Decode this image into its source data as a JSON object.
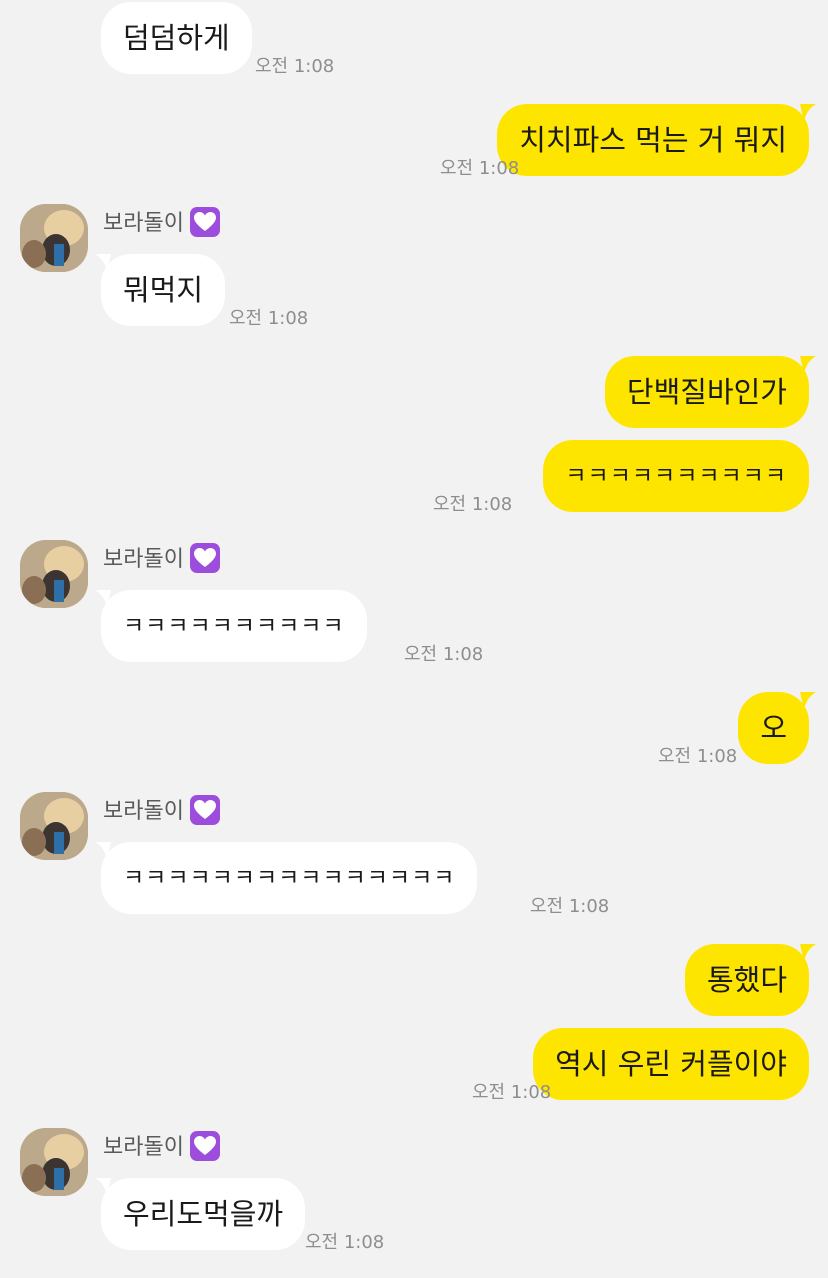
{
  "sender_name": "보라돌이",
  "colors": {
    "incoming_bubble": "#ffffff",
    "outgoing_bubble": "#fee500",
    "background": "#f2f2f2",
    "heart_badge": "#9d4ddb"
  },
  "messages": [
    {
      "dir": "in",
      "text": "덤덤하게",
      "time": "오전 1:08"
    },
    {
      "dir": "out",
      "text": "치치파스 먹는 거 뭐지",
      "time": "오전 1:08"
    },
    {
      "dir": "in",
      "text": "뭐먹지",
      "time": "오전 1:08"
    },
    {
      "dir": "out",
      "text": "단백질바인가",
      "time": ""
    },
    {
      "dir": "out",
      "text": "ㅋㅋㅋㅋㅋㅋㅋㅋㅋㅋ",
      "time": "오전 1:08"
    },
    {
      "dir": "in",
      "text": "ㅋㅋㅋㅋㅋㅋㅋㅋㅋㅋ",
      "time": "오전 1:08"
    },
    {
      "dir": "out",
      "text": "오",
      "time": "오전 1:08"
    },
    {
      "dir": "in",
      "text": "ㅋㅋㅋㅋㅋㅋㅋㅋㅋㅋㅋㅋㅋㅋㅋ",
      "time": "오전 1:08"
    },
    {
      "dir": "out",
      "text": "통했다",
      "time": ""
    },
    {
      "dir": "out",
      "text": "역시 우린 커플이야",
      "time": "오전 1:08"
    },
    {
      "dir": "in",
      "text": "우리도먹을까",
      "time": "오전 1:08"
    }
  ]
}
